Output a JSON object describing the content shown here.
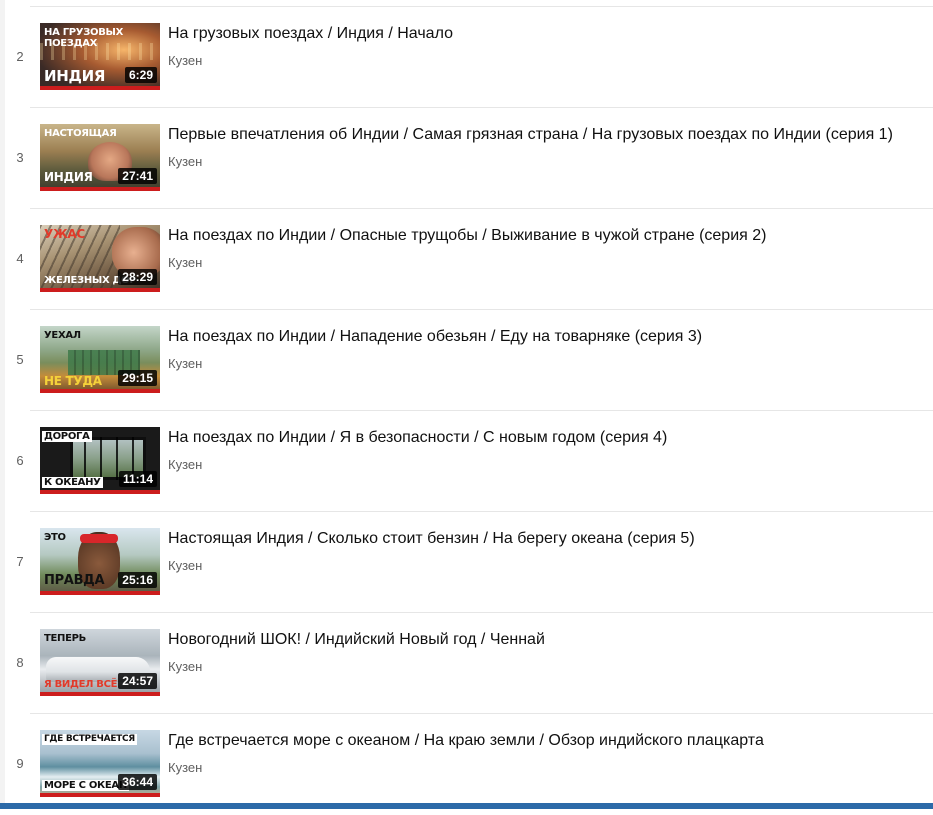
{
  "playlist": {
    "items": [
      {
        "index": "2",
        "title": "На грузовых поездах / Индия / Начало",
        "channel": "Кузен",
        "duration": "6:29",
        "thumb_top": "НА ГРУЗОВЫХ ПОЕЗДАХ",
        "thumb_bottom": "ИНДИЯ",
        "watched_fraction": 1.0
      },
      {
        "index": "3",
        "title": "Первые впечатления об Индии / Самая грязная страна / На грузовых поездах по Индии (серия 1)",
        "channel": "Кузен",
        "duration": "27:41",
        "thumb_top": "НАСТОЯЩАЯ",
        "thumb_bottom": "ИНДИЯ",
        "watched_fraction": 1.0
      },
      {
        "index": "4",
        "title": "На поездах по Индии / Опасные трущобы / Выживание в чужой стране (серия 2)",
        "channel": "Кузен",
        "duration": "28:29",
        "thumb_top": "УЖАС",
        "thumb_bottom": "ЖЕЛЕЗНЫХ ДОР",
        "watched_fraction": 1.0
      },
      {
        "index": "5",
        "title": "На поездах по Индии / Нападение обезьян / Еду на товарняке (серия 3)",
        "channel": "Кузен",
        "duration": "29:15",
        "thumb_top": "УЕХАЛ",
        "thumb_bottom": "НЕ ТУДА",
        "watched_fraction": 1.0
      },
      {
        "index": "6",
        "title": "На поездах по Индии / Я в безопасности / С новым годом (серия 4)",
        "channel": "Кузен",
        "duration": "11:14",
        "thumb_top": "ДОРОГА",
        "thumb_bottom": "К ОКЕАНУ",
        "watched_fraction": 1.0
      },
      {
        "index": "7",
        "title": "Настоящая Индия / Сколько стоит бензин / На берегу океана (серия 5)",
        "channel": "Кузен",
        "duration": "25:16",
        "thumb_top": "ЭТО",
        "thumb_bottom": "ПРАВДА",
        "watched_fraction": 1.0
      },
      {
        "index": "8",
        "title": "Новогодний ШОК! / Индийский Новый год / Ченнай",
        "channel": "Кузен",
        "duration": "24:57",
        "thumb_top": "ТЕПЕРЬ",
        "thumb_bottom": "Я ВИДЕЛ ВСЁ",
        "watched_fraction": 1.0
      },
      {
        "index": "9",
        "title": "Где встречается море с океаном / На краю земли / Обзор индийского плацкарта",
        "channel": "Кузен",
        "duration": "36:44",
        "thumb_top": "ГДЕ ВСТРЕЧАЕТСЯ",
        "thumb_bottom": "МОРЕ С ОКЕАН",
        "watched_fraction": 1.0
      }
    ]
  },
  "colors": {
    "progress_bar": "#cc1d1d",
    "title_text": "#111111",
    "meta_text": "#606060",
    "separator": "#e6e6e6",
    "taskbar": "#2c6aa8"
  }
}
